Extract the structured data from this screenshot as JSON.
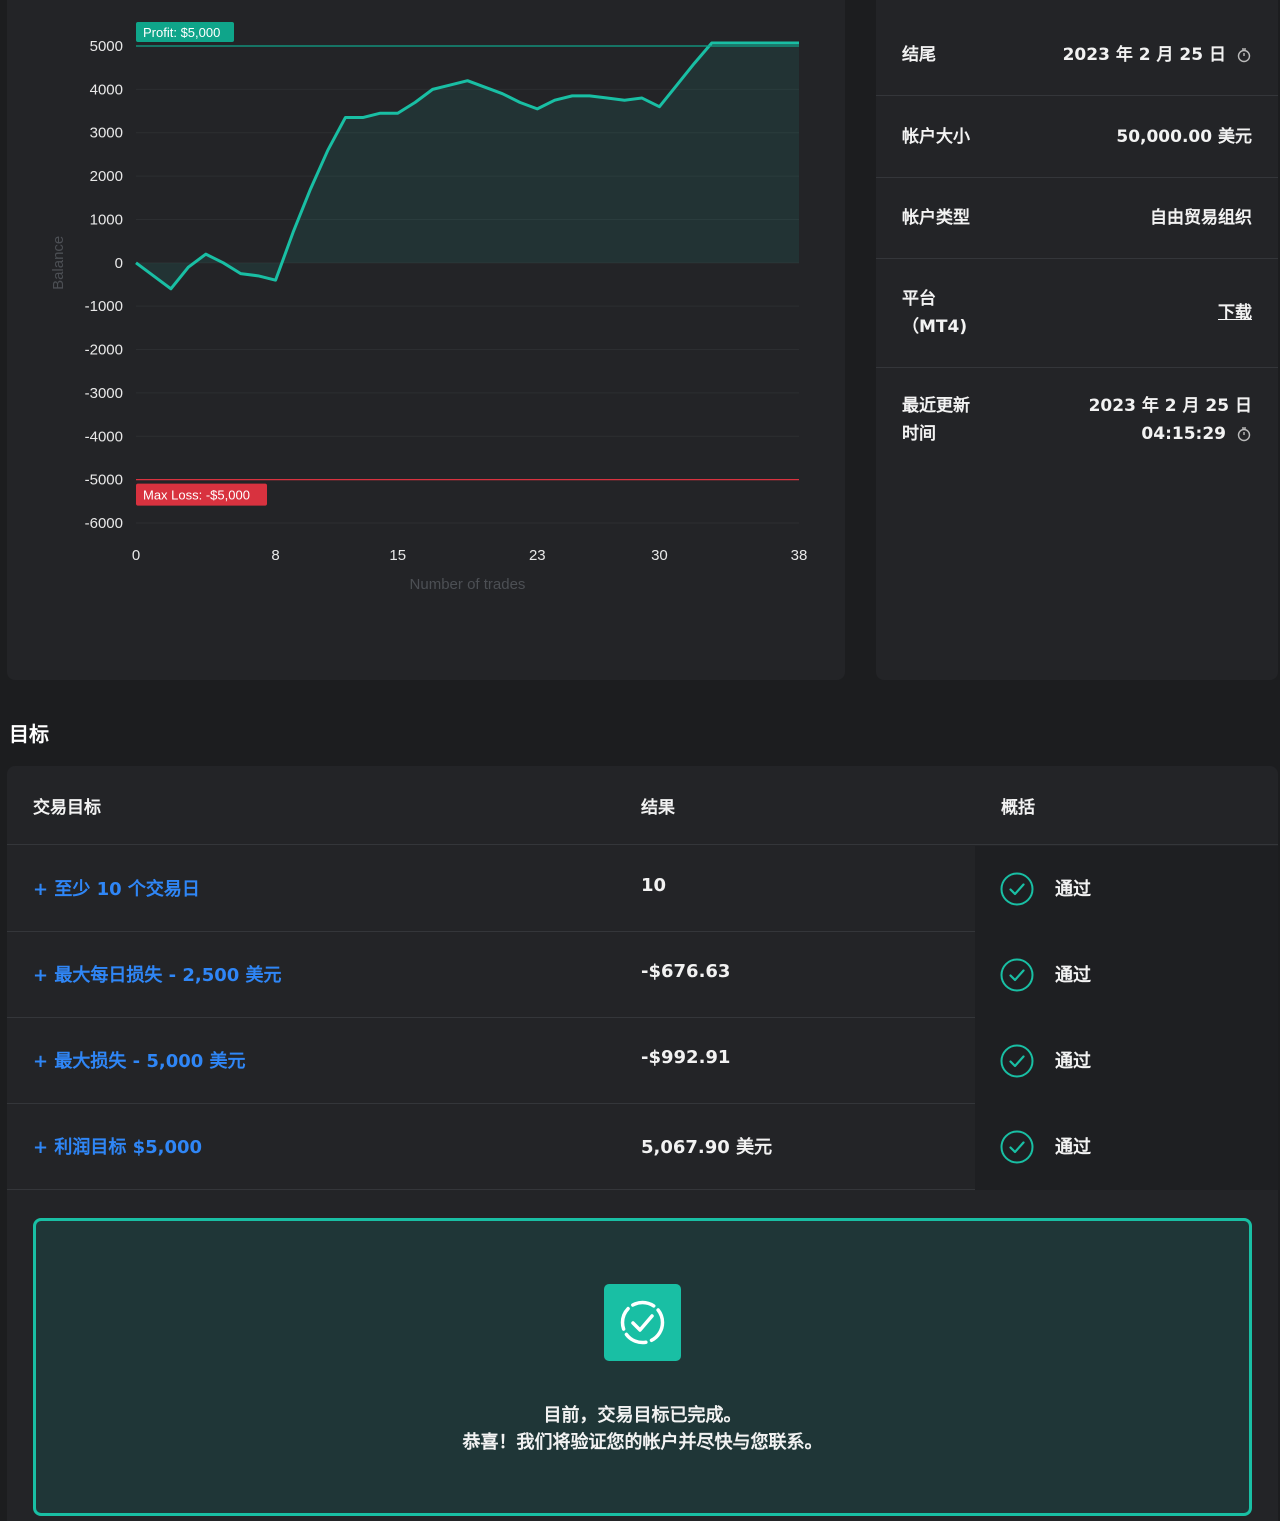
{
  "chart_data": {
    "type": "area",
    "xlabel": "Number of trades",
    "ylabel": "Balance",
    "ylim": [
      -6000,
      5000
    ],
    "yticks": [
      "5000",
      "4000",
      "3000",
      "2000",
      "1000",
      "0",
      "-1000",
      "-2000",
      "-3000",
      "-4000",
      "-5000",
      "-6000"
    ],
    "xticks": [
      "0",
      "8",
      "15",
      "23",
      "30",
      "38"
    ],
    "xrange": [
      0,
      38
    ],
    "grid": true,
    "profit_target": {
      "label": "Profit: $5,000",
      "value": 5000,
      "color": "#0fa58a"
    },
    "max_loss": {
      "label": "Max Loss: -$5,000",
      "value": -5000,
      "color": "#d8323f"
    },
    "series": [
      {
        "color": "#19bfa4",
        "x": [
          0,
          1,
          2,
          3,
          4,
          5,
          6,
          7,
          8,
          9,
          10,
          11,
          12,
          13,
          14,
          15,
          16,
          17,
          18,
          19,
          20,
          21,
          22,
          23,
          24,
          25,
          26,
          27,
          28,
          29,
          30,
          31,
          32,
          33,
          34,
          35,
          36,
          37,
          38
        ],
        "y": [
          0,
          -300,
          -600,
          -100,
          200,
          0,
          -250,
          -300,
          -400,
          700,
          1700,
          2600,
          3350,
          3350,
          3450,
          3450,
          3700,
          4000,
          4100,
          4200,
          4050,
          3900,
          3700,
          3550,
          3750,
          3850,
          3850,
          3800,
          3750,
          3800,
          3600,
          4100,
          4600,
          5070,
          5070,
          5070,
          5070,
          5070,
          5070
        ]
      }
    ]
  },
  "info": {
    "end_label": "结尾",
    "end_value": "2023 年 2 月 25 日",
    "size_label": "帐户大小",
    "size_value": "50,000.00 美元",
    "type_label": "帐户类型",
    "type_value": "自由贸易组织",
    "platform_label_1": "平台",
    "platform_label_2": "（MT4)",
    "platform_value": "下载",
    "updated_label_1": "最近更新",
    "updated_label_2": "时间",
    "updated_value_1": "2023 年 2 月 25 日",
    "updated_value_2": "04:15:29"
  },
  "goals": {
    "title": "目标",
    "col_goal": "交易目标",
    "col_result": "结果",
    "col_summary": "概括",
    "rows": [
      {
        "name": "+ 至少 10 个交易日",
        "result": "10",
        "status": "通过"
      },
      {
        "name": "+ 最大每日损失 - 2,500 美元",
        "result": "-$676.63",
        "status": "通过"
      },
      {
        "name": "+ 最大损失 - 5,000 美元",
        "result": "-$992.91",
        "status": "通过"
      },
      {
        "name": "+ 利润目标 $5,000",
        "result": "5,067.90 美元",
        "status": "通过"
      }
    ],
    "success_line_1": "目前，交易目标已完成。",
    "success_line_2": "恭喜！我们将验证您的帐户并尽快与您联系。"
  },
  "colors": {
    "accent": "#19bfa4",
    "link": "#2f86f6",
    "danger": "#d8323f",
    "card": "#232427",
    "background": "#1c1d1f"
  }
}
